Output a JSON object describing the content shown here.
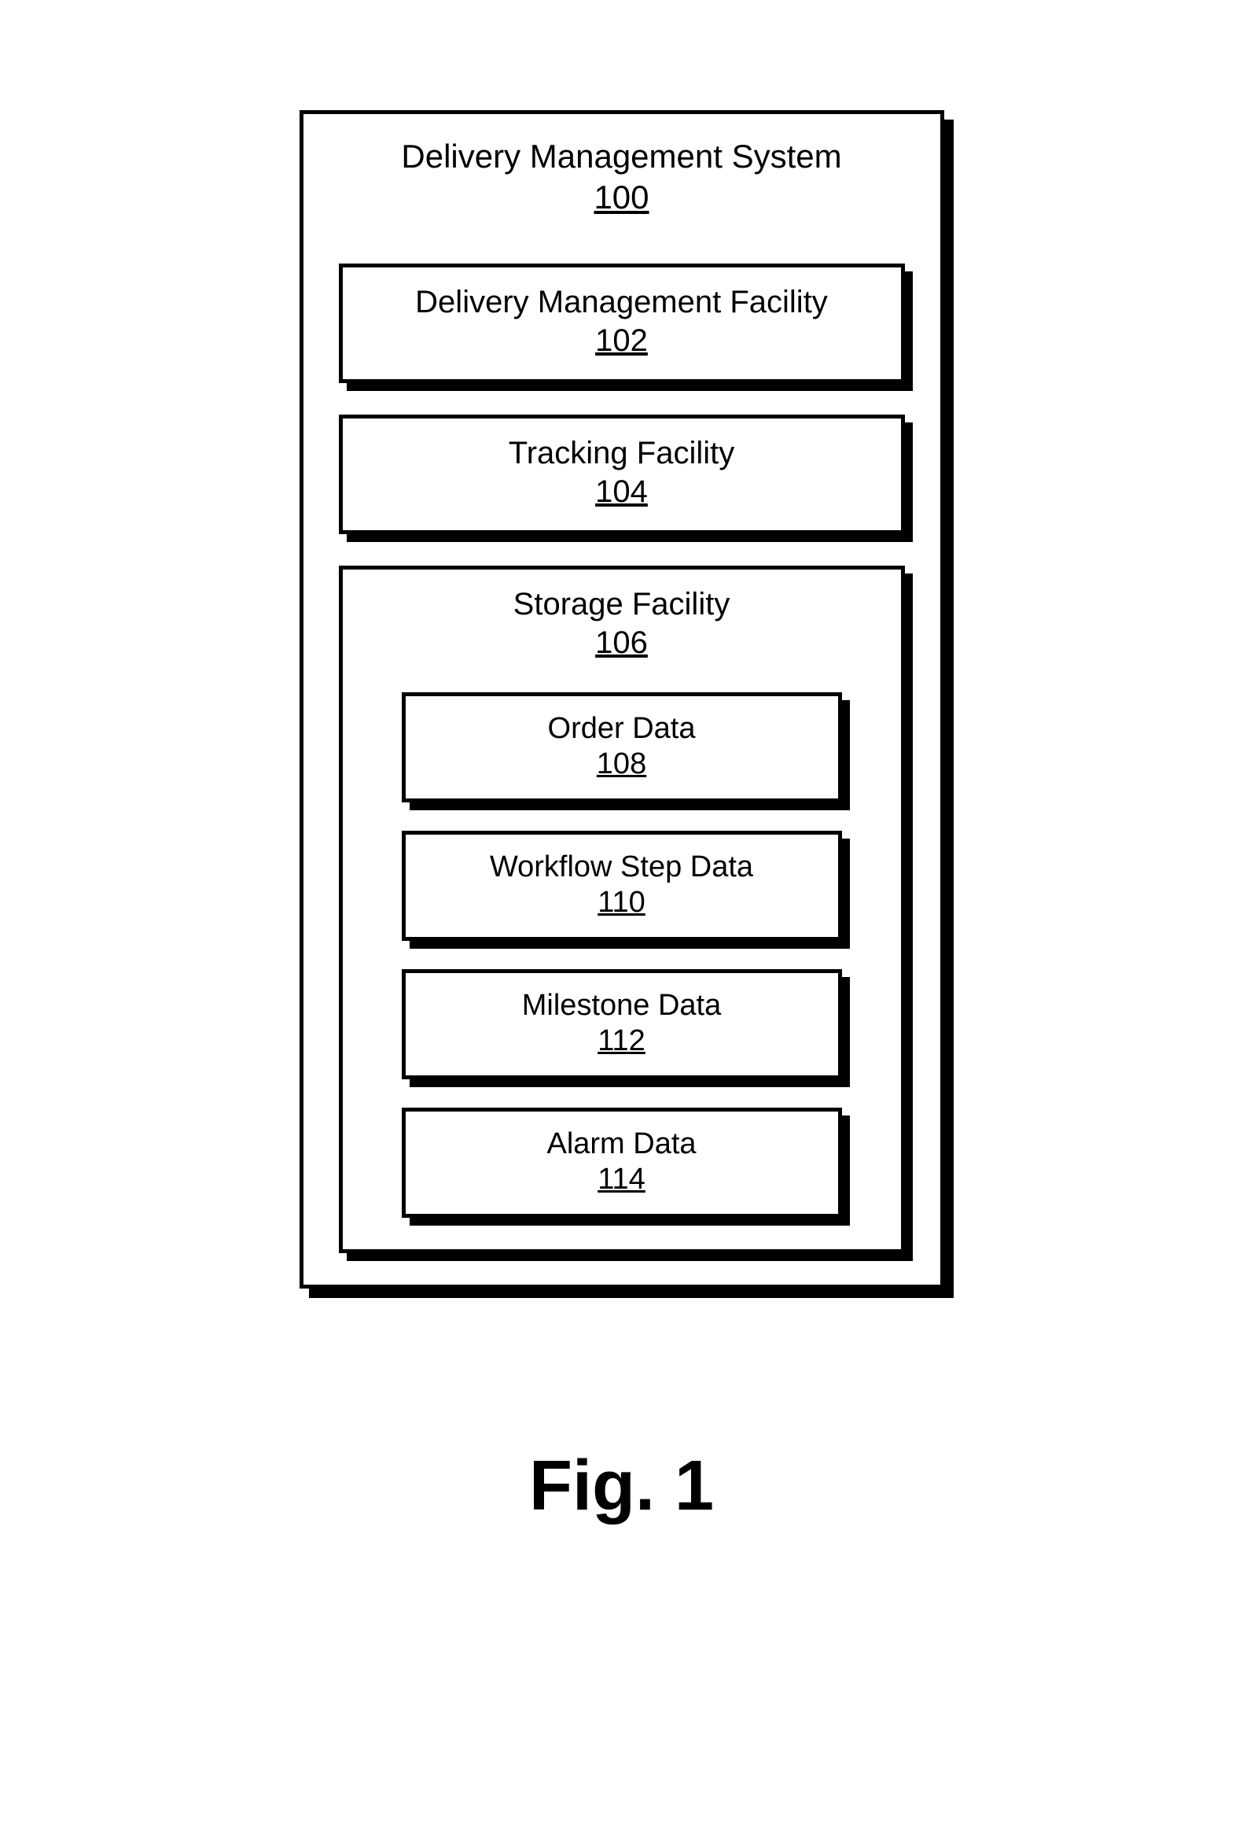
{
  "system": {
    "title": "Delivery Management System",
    "ref": "100",
    "facilities": [
      {
        "title": "Delivery Management Facility",
        "ref": "102"
      },
      {
        "title": "Tracking Facility",
        "ref": "104"
      }
    ],
    "storage": {
      "title": "Storage Facility",
      "ref": "106",
      "data_items": [
        {
          "title": "Order Data",
          "ref": "108"
        },
        {
          "title": "Workflow Step Data",
          "ref": "110"
        },
        {
          "title": "Milestone Data",
          "ref": "112"
        },
        {
          "title": "Alarm Data",
          "ref": "114"
        }
      ]
    }
  },
  "figure_label": "Fig. 1"
}
